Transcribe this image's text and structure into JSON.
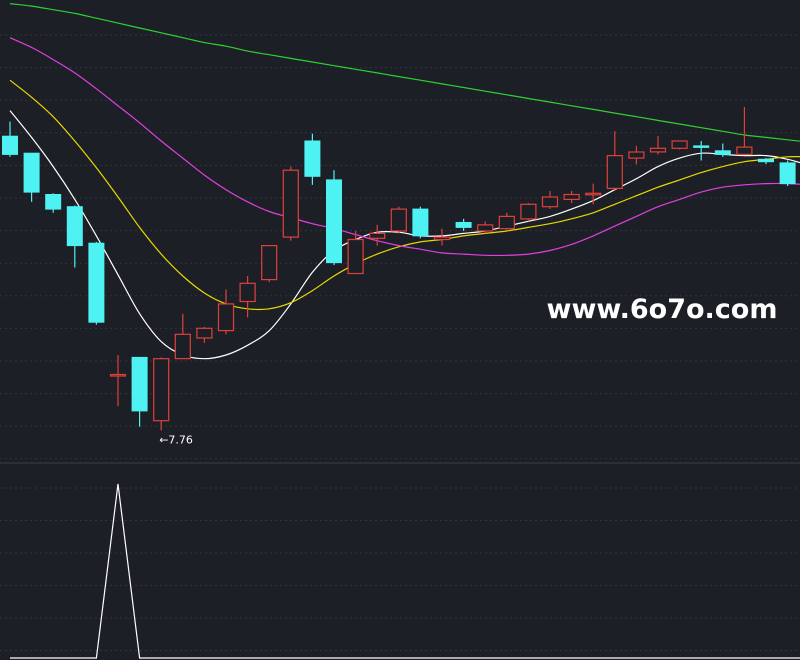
{
  "chart_data": {
    "type": "candlestick",
    "title": "",
    "xlabel": "",
    "ylabel": "",
    "grid": true,
    "ylim": [
      7.5,
      11.3
    ],
    "colors": {
      "background": "#1c1f26",
      "grid": "#2f3440",
      "up": "#e0403a",
      "down": "#4ef2f2",
      "ma_short": "#ffffff",
      "ma_mid": "#e8d800",
      "ma_long": "#e040e0",
      "ma_longest": "#30d030",
      "indicator": "#ffffff",
      "watermark": "#ffffff",
      "annotation": "#ffffff"
    },
    "candles": [
      {
        "open": 10.18,
        "close": 10.03,
        "high": 10.3,
        "low": 10.01
      },
      {
        "open": 10.04,
        "close": 9.72,
        "high": 10.04,
        "low": 9.64
      },
      {
        "open": 9.7,
        "close": 9.58,
        "high": 9.71,
        "low": 9.55
      },
      {
        "open": 9.6,
        "close": 9.28,
        "high": 9.61,
        "low": 9.1
      },
      {
        "open": 9.3,
        "close": 8.65,
        "high": 9.31,
        "low": 8.63
      },
      {
        "open": 8.22,
        "close": 8.22,
        "high": 8.38,
        "low": 7.96
      },
      {
        "open": 8.36,
        "close": 7.92,
        "high": 8.36,
        "low": 7.79
      },
      {
        "open": 7.84,
        "close": 8.35,
        "high": 8.36,
        "low": 7.76
      },
      {
        "open": 8.35,
        "close": 8.55,
        "high": 8.72,
        "low": 8.35
      },
      {
        "open": 8.52,
        "close": 8.6,
        "high": 8.61,
        "low": 8.48
      },
      {
        "open": 8.58,
        "close": 8.8,
        "high": 8.92,
        "low": 8.55
      },
      {
        "open": 8.82,
        "close": 8.97,
        "high": 9.03,
        "low": 8.69
      },
      {
        "open": 9.0,
        "close": 9.28,
        "high": 9.28,
        "low": 8.98
      },
      {
        "open": 9.35,
        "close": 9.9,
        "high": 9.93,
        "low": 9.32
      },
      {
        "open": 10.14,
        "close": 9.85,
        "high": 10.2,
        "low": 9.78
      },
      {
        "open": 9.82,
        "close": 9.14,
        "high": 9.9,
        "low": 9.12
      },
      {
        "open": 9.05,
        "close": 9.33,
        "high": 9.4,
        "low": 9.05
      },
      {
        "open": 9.34,
        "close": 9.38,
        "high": 9.45,
        "low": 9.28
      },
      {
        "open": 9.4,
        "close": 9.58,
        "high": 9.6,
        "low": 9.38
      },
      {
        "open": 9.58,
        "close": 9.36,
        "high": 9.6,
        "low": 9.34
      },
      {
        "open": 9.33,
        "close": 9.35,
        "high": 9.42,
        "low": 9.28
      },
      {
        "open": 9.47,
        "close": 9.43,
        "high": 9.5,
        "low": 9.4
      },
      {
        "open": 9.4,
        "close": 9.45,
        "high": 9.48,
        "low": 9.38
      },
      {
        "open": 9.42,
        "close": 9.52,
        "high": 9.55,
        "low": 9.41
      },
      {
        "open": 9.5,
        "close": 9.62,
        "high": 9.63,
        "low": 9.48
      },
      {
        "open": 9.6,
        "close": 9.68,
        "high": 9.73,
        "low": 9.58
      },
      {
        "open": 9.66,
        "close": 9.7,
        "high": 9.73,
        "low": 9.63
      },
      {
        "open": 9.7,
        "close": 9.71,
        "high": 9.79,
        "low": 9.62
      },
      {
        "open": 9.75,
        "close": 10.02,
        "high": 10.22,
        "low": 9.73
      },
      {
        "open": 10.0,
        "close": 10.05,
        "high": 10.1,
        "low": 9.95
      },
      {
        "open": 10.05,
        "close": 10.08,
        "high": 10.18,
        "low": 10.03
      },
      {
        "open": 10.08,
        "close": 10.14,
        "high": 10.14,
        "low": 10.07
      },
      {
        "open": 10.1,
        "close": 10.09,
        "high": 10.14,
        "low": 9.98
      },
      {
        "open": 10.06,
        "close": 10.03,
        "high": 10.12,
        "low": 10.01
      },
      {
        "open": 10.03,
        "close": 10.09,
        "high": 10.42,
        "low": 10.03
      },
      {
        "open": 9.99,
        "close": 9.97,
        "high": 10.0,
        "low": 9.95
      },
      {
        "open": 9.96,
        "close": 9.79,
        "high": 9.98,
        "low": 9.77
      },
      {
        "open": 9.79,
        "close": 9.87,
        "high": 9.87,
        "low": 9.75
      }
    ],
    "moving_averages": [
      {
        "key": "ma_short",
        "values": [
          10.39,
          10.17,
          9.93,
          9.66,
          9.36,
          9.04,
          8.72,
          8.49,
          8.38,
          8.35,
          8.38,
          8.46,
          8.58,
          8.8,
          9.06,
          9.24,
          9.33,
          9.39,
          9.39,
          9.36,
          9.36,
          9.38,
          9.4,
          9.44,
          9.48,
          9.52,
          9.58,
          9.65,
          9.74,
          9.83,
          9.93,
          10.0,
          10.04,
          10.03,
          10.02,
          10.02,
          9.99,
          9.94
        ]
      },
      {
        "key": "ma_mid",
        "values": [
          10.64,
          10.5,
          10.34,
          10.14,
          9.92,
          9.68,
          9.43,
          9.21,
          9.03,
          8.89,
          8.8,
          8.76,
          8.76,
          8.81,
          8.91,
          9.03,
          9.13,
          9.21,
          9.27,
          9.31,
          9.33,
          9.36,
          9.38,
          9.4,
          9.43,
          9.46,
          9.5,
          9.55,
          9.62,
          9.69,
          9.76,
          9.82,
          9.88,
          9.93,
          9.97,
          9.99,
          10.01,
          10.01
        ]
      },
      {
        "key": "ma_long",
        "values": [
          10.99,
          10.91,
          10.81,
          10.7,
          10.57,
          10.43,
          10.29,
          10.14,
          10.0,
          9.86,
          9.74,
          9.64,
          9.56,
          9.51,
          9.46,
          9.42,
          9.37,
          9.32,
          9.28,
          9.25,
          9.22,
          9.21,
          9.2,
          9.2,
          9.21,
          9.24,
          9.29,
          9.36,
          9.44,
          9.52,
          9.6,
          9.66,
          9.72,
          9.76,
          9.78,
          9.79,
          9.79,
          9.78
        ]
      },
      {
        "key": "ma_longest",
        "values": [
          11.27,
          11.25,
          11.22,
          11.19,
          11.15,
          11.11,
          11.07,
          11.03,
          10.99,
          10.95,
          10.92,
          10.88,
          10.85,
          10.82,
          10.79,
          10.76,
          10.73,
          10.7,
          10.67,
          10.64,
          10.61,
          10.58,
          10.55,
          10.52,
          10.49,
          10.46,
          10.43,
          10.4,
          10.37,
          10.34,
          10.31,
          10.28,
          10.25,
          10.22,
          10.19,
          10.17,
          10.15,
          10.13
        ]
      }
    ],
    "annotations": [
      {
        "candle_index": 7,
        "text": "←7.76"
      }
    ],
    "indicator": {
      "values": [
        0,
        0,
        0,
        0,
        0,
        1,
        0,
        0,
        0,
        0,
        0,
        0,
        0,
        0,
        0,
        0,
        0,
        0,
        0,
        0,
        0,
        0,
        0,
        0,
        0,
        0,
        0,
        0,
        0,
        0,
        0,
        0,
        0,
        0,
        0,
        0,
        0,
        0
      ]
    }
  },
  "watermark": {
    "text": "www.6o7o.com"
  }
}
